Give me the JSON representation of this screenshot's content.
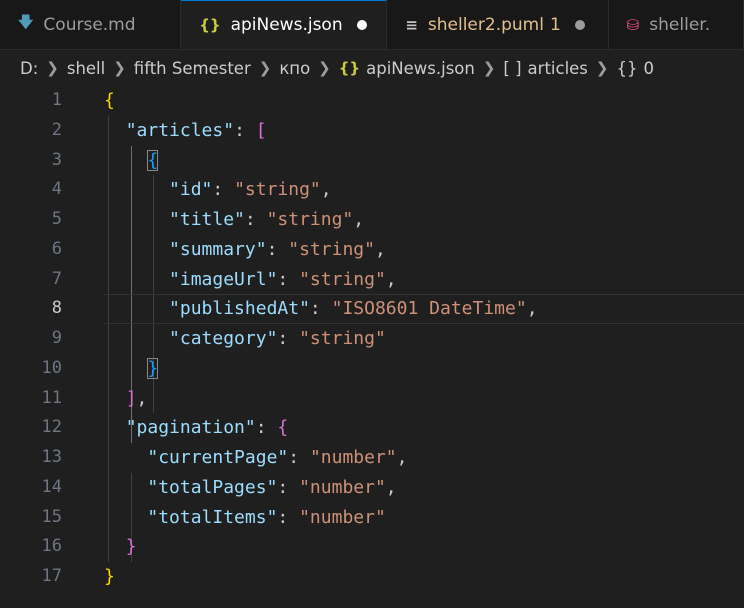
{
  "tabs": [
    {
      "label": "Course.md",
      "icon": "markdown-icon",
      "active": false
    },
    {
      "label": "apiNews.json",
      "icon": "json-icon",
      "active": true,
      "dirty": true
    },
    {
      "label": "sheller2.puml",
      "icon": "puml-icon",
      "count": "1",
      "dirty": true
    },
    {
      "label": "sheller.",
      "icon": "database-icon"
    }
  ],
  "breadcrumb": {
    "drive": "D:",
    "folder1": "shell",
    "folder2": "fifth Semester",
    "folder3": "кпо",
    "file": "apiNews.json",
    "node1": "articles",
    "node2": "0",
    "file_icon": "{}",
    "node1_icon": "[ ]",
    "node2_icon": "{}"
  },
  "editor": {
    "active_line": 8,
    "line_numbers": [
      "1",
      "2",
      "3",
      "4",
      "5",
      "6",
      "7",
      "8",
      "9",
      "10",
      "11",
      "12",
      "13",
      "14",
      "15",
      "16",
      "17"
    ],
    "tokens": {
      "l1_open": "{",
      "l2_key": "\"articles\"",
      "l2_colon": ": ",
      "l2_open": "[",
      "l3_open": "{",
      "l4_key": "\"id\"",
      "l4_val": "\"string\"",
      "l5_key": "\"title\"",
      "l5_val": "\"string\"",
      "l6_key": "\"summary\"",
      "l6_val": "\"string\"",
      "l7_key": "\"imageUrl\"",
      "l7_val": "\"string\"",
      "l8_key": "\"publishedAt\"",
      "l8_val": "\"ISO8601 DateTime\"",
      "l9_key": "\"category\"",
      "l9_val": "\"string\"",
      "l10_close": "}",
      "l11_close": "]",
      "l11_comma": ",",
      "l12_key": "\"pagination\"",
      "l12_open": "{",
      "l13_key": "\"currentPage\"",
      "l13_val": "\"number\"",
      "l14_key": "\"totalPages\"",
      "l14_val": "\"number\"",
      "l15_key": "\"totalItems\"",
      "l15_val": "\"number\"",
      "l16_close": "}",
      "l17_close": "}",
      "colon": ": ",
      "comma": ","
    }
  },
  "colors": {
    "editor_bg": "#1f1f1f",
    "key": "#9cdcfe",
    "string": "#ce9178",
    "bracket_level1": "#ffd700",
    "bracket_level2": "#da70d6",
    "bracket_level3": "#179fff",
    "modified": "#e2c08d"
  }
}
